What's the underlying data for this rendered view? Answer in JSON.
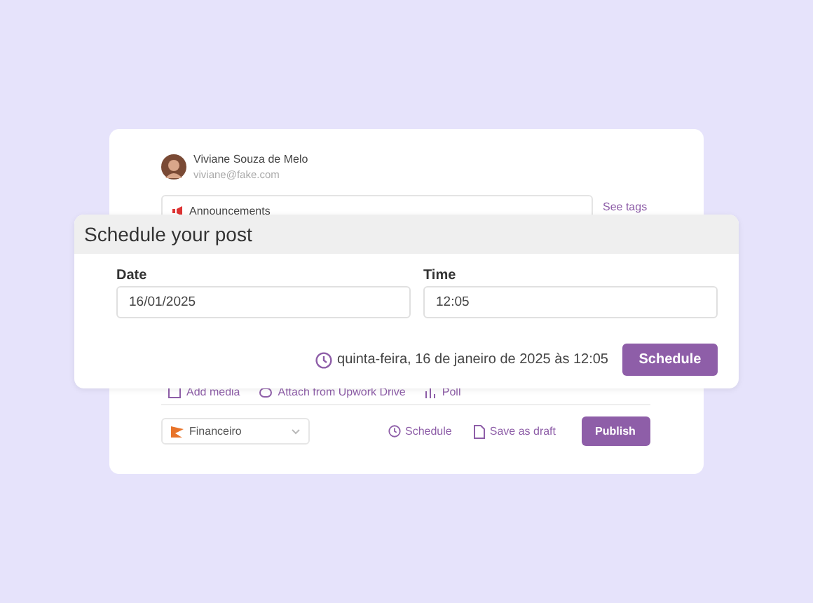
{
  "author": {
    "name": "Viviane Souza de Melo",
    "email": "viviane@fake.com"
  },
  "tag_field": {
    "value": "Announcements"
  },
  "see_tags": "See tags",
  "attachments": [
    {
      "kind": "media",
      "label": "Add media"
    },
    {
      "kind": "drive",
      "label": "Attach from Upwork Drive"
    },
    {
      "kind": "poll",
      "label": "Poll"
    }
  ],
  "category": {
    "value": "Financeiro"
  },
  "actions": {
    "schedule": "Schedule",
    "draft": "Save as draft",
    "publish": "Publish"
  },
  "modal": {
    "title": "Schedule your post",
    "date_label": "Date",
    "date_value": "16/01/2025",
    "time_label": "Time",
    "time_value": "12:05",
    "summary": "quinta-feira, 16 de janeiro de 2025 às 12:05",
    "button": "Schedule"
  }
}
